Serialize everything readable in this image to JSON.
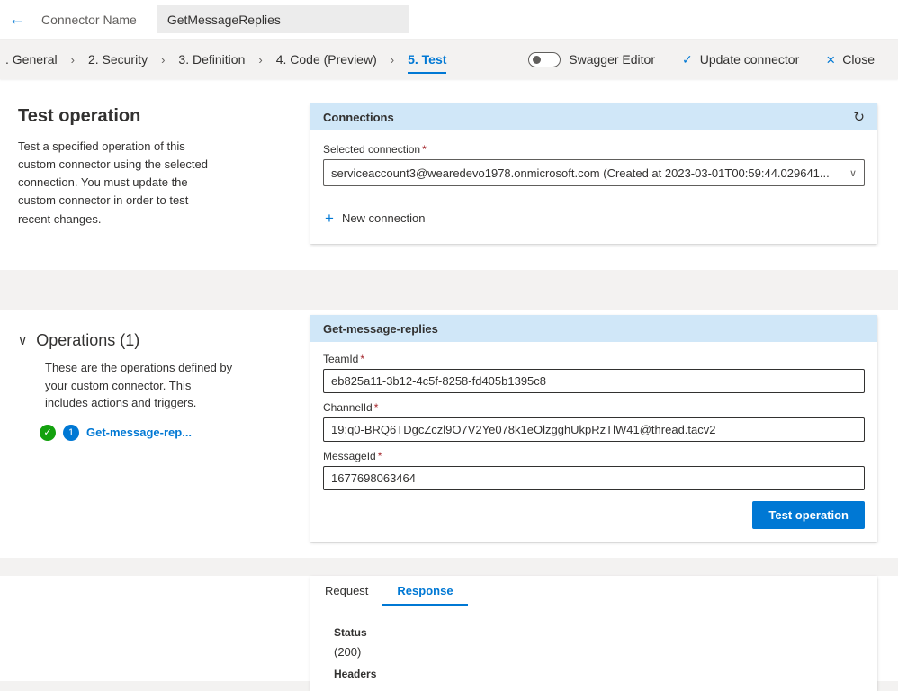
{
  "icons": {
    "back": "←",
    "separator": "›",
    "refresh": "↻",
    "plus": "+",
    "chevron_down": "∨",
    "caret_down": "∨",
    "check": "✓",
    "close": "×",
    "operation_check": "✓"
  },
  "colors": {
    "accent": "#0078d4",
    "card_header": "#d0e7f8",
    "success_green": "#13a10e",
    "required_red": "#a4262c"
  },
  "topbar": {
    "connector_name_label": "Connector Name",
    "connector_name_value": "GetMessageReplies"
  },
  "nav": {
    "steps": [
      {
        "label": ". General"
      },
      {
        "label": "2. Security"
      },
      {
        "label": "3. Definition"
      },
      {
        "label": "4. Code (Preview)"
      },
      {
        "label": "5. Test"
      }
    ],
    "swagger_toggle_label": "Swagger Editor",
    "update_connector_label": "Update connector",
    "close_label": "Close"
  },
  "test_section": {
    "title": "Test operation",
    "description": "Test a specified operation of this custom connector using the selected connection. You must update the custom connector in order to test recent changes."
  },
  "connections_card": {
    "title": "Connections",
    "selected_connection_label": "Selected connection",
    "required_mark": "*",
    "selected_connection_value": "serviceaccount3@wearedevo1978.onmicrosoft.com (Created at 2023-03-01T00:59:44.029641...",
    "new_connection_label": "New connection"
  },
  "operations_section": {
    "title": "Operations (1)",
    "description": "These are the operations defined by your custom connector. This includes actions and triggers.",
    "operation_number": "1",
    "operation_link": "Get-message-rep..."
  },
  "operation_card": {
    "title": "Get-message-replies",
    "fields": [
      {
        "label": "TeamId",
        "value": "eb825a11-3b12-4c5f-8258-fd405b1395c8"
      },
      {
        "label": "ChannelId",
        "value": "19:q0-BRQ6TDgcZczl9O7V2Ye078k1eOlzgghUkpRzTlW41@thread.tacv2"
      },
      {
        "label": "MessageId",
        "value": "1677698063464"
      }
    ],
    "test_button_label": "Test operation"
  },
  "result_card": {
    "tabs": [
      {
        "label": "Request"
      },
      {
        "label": "Response"
      }
    ],
    "status_label": "Status",
    "status_value": "(200)",
    "headers_label": "Headers"
  }
}
